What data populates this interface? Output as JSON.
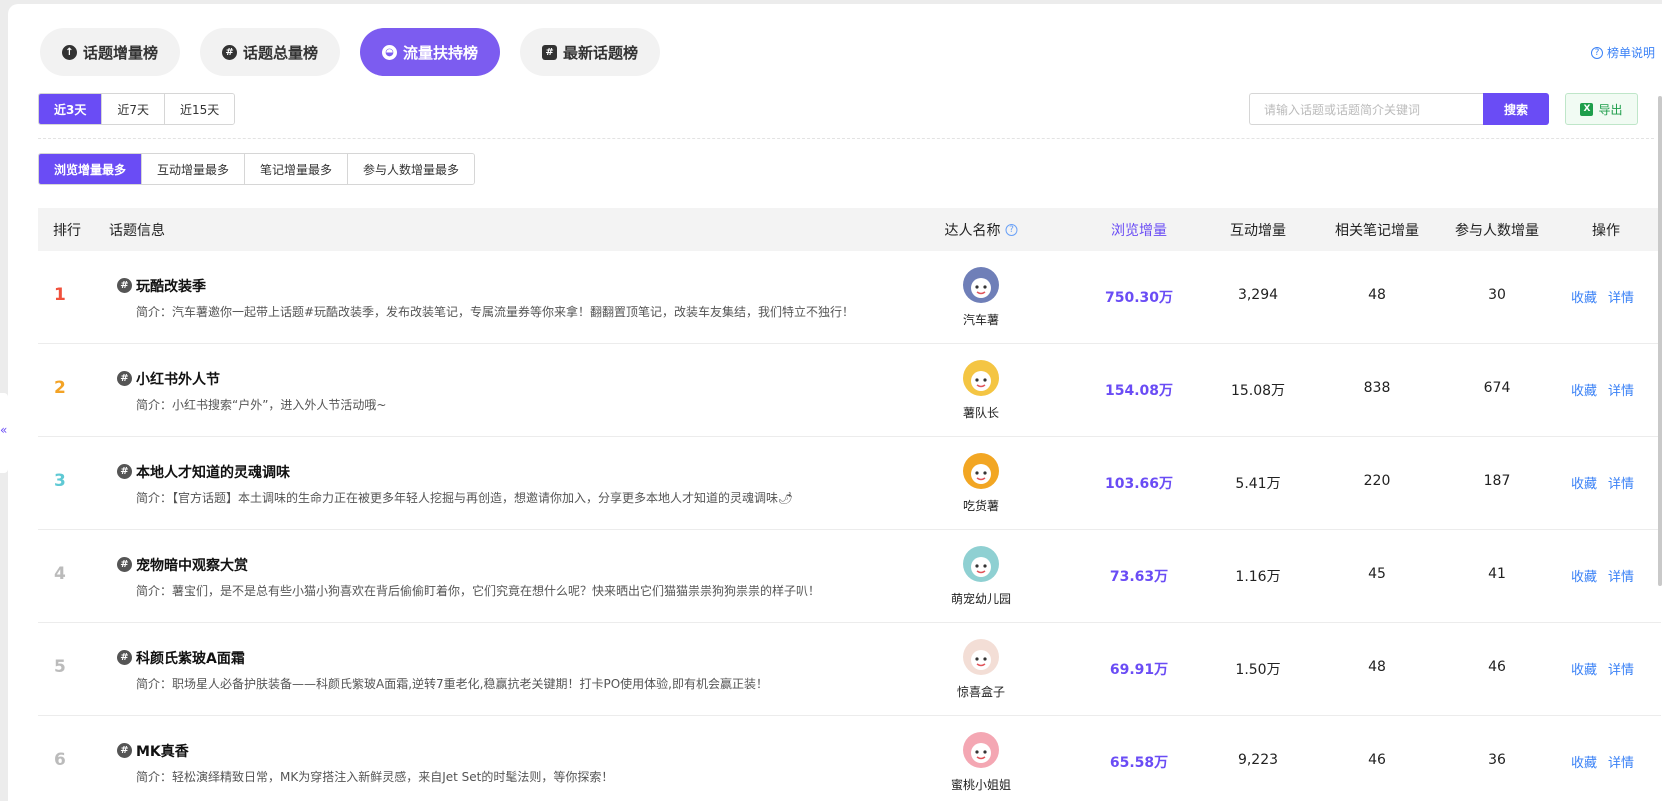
{
  "tabs": [
    {
      "label": "话题增量榜",
      "icon": "up-arrow-icon",
      "active": false
    },
    {
      "label": "话题总量榜",
      "icon": "hash-icon",
      "active": false
    },
    {
      "label": "流量扶持榜",
      "icon": "traffic-icon",
      "active": true
    },
    {
      "label": "最新话题榜",
      "icon": "new-topic-icon",
      "active": false
    }
  ],
  "help_link": "榜单说明",
  "time_range": [
    "近3天",
    "近7天",
    "近15天"
  ],
  "sort_options": [
    "浏览增量最多",
    "互动增量最多",
    "笔记增量最多",
    "参与人数增量最多"
  ],
  "search": {
    "placeholder": "请输入话题或话题简介关键词",
    "button": "搜索"
  },
  "export_label": "导出",
  "columns": {
    "rank": "排行",
    "topic": "话题信息",
    "creator": "达人名称",
    "views": "浏览增量",
    "interactions": "互动增量",
    "notes": "相关笔记增量",
    "participants": "参与人数增量",
    "actions": "操作"
  },
  "actions": {
    "collect": "收藏",
    "detail": "详情"
  },
  "rank_colors": {
    "1": "#f0513c",
    "2": "#f3a326",
    "3": "#5fc9d4",
    "other": "#bbbbbb"
  },
  "accent": "#6a4cf5",
  "rows": [
    {
      "rank": "1",
      "title": "玩酷改装季",
      "desc": "简介：汽车薯邀你一起带上话题#玩酷改装季，发布改装笔记，专属流量券等你来拿！翻翻置顶笔记，改装车友集结，我们特立不独行！",
      "creator": "汽车薯",
      "views": "750.30万",
      "interactions": "3,294",
      "notes": "48",
      "participants": "30",
      "avatar_color": "#6f7fb8"
    },
    {
      "rank": "2",
      "title": "小红书外人节",
      "desc": "简介：小红书搜索“户外”，进入外人节活动哦~",
      "creator": "薯队长",
      "views": "154.08万",
      "interactions": "15.08万",
      "notes": "838",
      "participants": "674",
      "avatar_color": "#f4c543"
    },
    {
      "rank": "3",
      "title": "本地人才知道的灵魂调味",
      "desc": "简介：【官方话题】本土调味的生命力正在被更多年轻人挖掘与再创造，想邀请你加入，分享更多本地人才知道的灵魂调味🌶",
      "creator": "吃货薯",
      "views": "103.66万",
      "interactions": "5.41万",
      "notes": "220",
      "participants": "187",
      "avatar_color": "#f2a623"
    },
    {
      "rank": "4",
      "title": "宠物暗中观察大赏",
      "desc": "简介：薯宝们，是不是总有些小猫小狗喜欢在背后偷偷盯着你，它们究竟在想什么呢？快来晒出它们猫猫祟祟狗狗祟祟的样子叭！",
      "creator": "萌宠幼儿园",
      "views": "73.63万",
      "interactions": "1.16万",
      "notes": "45",
      "participants": "41",
      "avatar_color": "#8fd0d2"
    },
    {
      "rank": "5",
      "title": "科颜氏紫玻A面霜",
      "desc": "简介：职场星人必备护肤装备——科颜氏紫玻A面霜,逆转7重老化,稳赢抗老关键期！打卡PO使用体验,即有机会赢正装！",
      "creator": "惊喜盒子",
      "views": "69.91万",
      "interactions": "1.50万",
      "notes": "48",
      "participants": "46",
      "avatar_color": "#f3ded6"
    },
    {
      "rank": "6",
      "title": "MK真香",
      "desc": "简介：轻松演绎精致日常，MK为穿搭注入新鲜灵感，来自Jet Set的时髦法则，等你探索！",
      "creator": "蜜桃小姐姐",
      "views": "65.58万",
      "interactions": "9,223",
      "notes": "46",
      "participants": "36",
      "avatar_color": "#f4a7b3"
    }
  ]
}
